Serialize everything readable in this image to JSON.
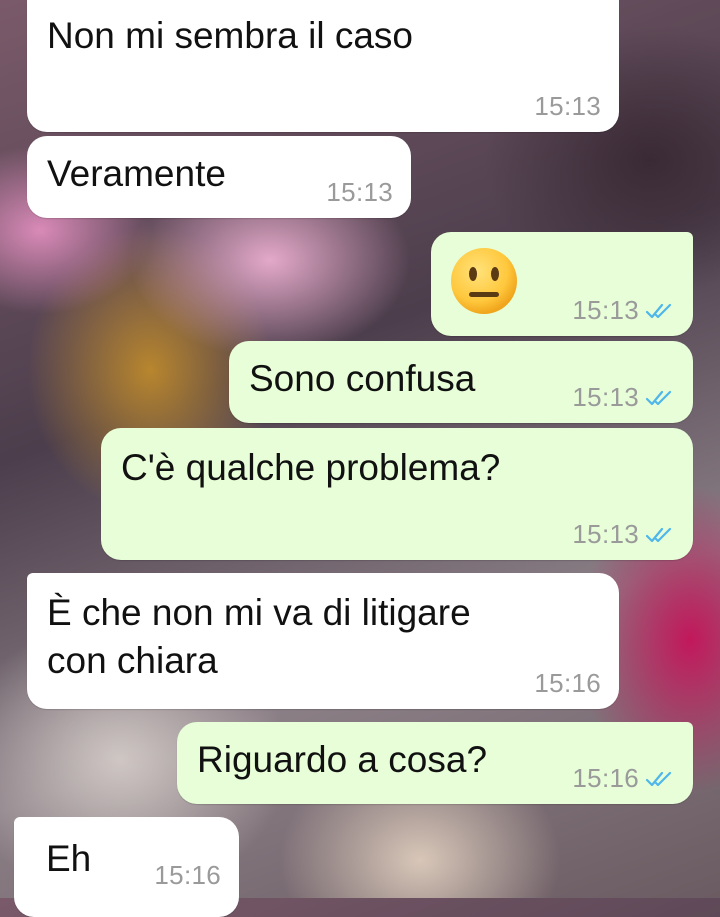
{
  "messages": [
    {
      "direction": "incoming",
      "text": "Non mi sembra il caso",
      "time": "15:13"
    },
    {
      "direction": "incoming",
      "text": "Veramente",
      "time": "15:13"
    },
    {
      "direction": "outgoing",
      "emoji": "neutral-face",
      "time": "15:13",
      "status": "read"
    },
    {
      "direction": "outgoing",
      "text": "Sono confusa",
      "time": "15:13",
      "status": "read"
    },
    {
      "direction": "outgoing",
      "text": "C'è qualche problema?",
      "time": "15:13",
      "status": "read"
    },
    {
      "direction": "incoming",
      "text_lines": [
        "È che non mi va di litigare",
        "con chiara"
      ],
      "time": "15:16"
    },
    {
      "direction": "outgoing",
      "text": "Riguardo a cosa?",
      "time": "15:16",
      "status": "read"
    },
    {
      "direction": "incoming",
      "text": "Eh",
      "time": "15:16"
    }
  ],
  "colors": {
    "incoming_bubble": "#ffffff",
    "outgoing_bubble": "#e7fed8",
    "timestamp": "#9a9a9a",
    "read_ticks": "#4fb6ec"
  }
}
